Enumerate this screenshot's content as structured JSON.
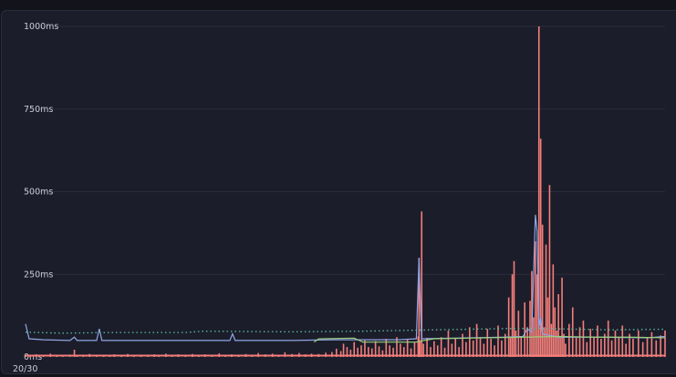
{
  "chart_data": {
    "type": "line",
    "ylim": [
      0,
      1000
    ],
    "yticks": [
      {
        "value": 0,
        "label": "0ms"
      },
      {
        "value": 250,
        "label": "250ms"
      },
      {
        "value": 500,
        "label": "500ms"
      },
      {
        "value": 750,
        "label": "750ms"
      },
      {
        "value": 1000,
        "label": "1000ms"
      }
    ],
    "xtick_label": "20/30",
    "grid": true,
    "legend": "none",
    "series": [
      {
        "color": "#f47e7a",
        "style": "spikes",
        "points": [
          [
            0,
            4
          ],
          [
            5,
            6
          ],
          [
            12,
            8
          ],
          [
            20,
            5
          ],
          [
            28,
            10
          ],
          [
            35,
            4
          ],
          [
            42,
            6
          ],
          [
            50,
            7
          ],
          [
            55,
            22
          ],
          [
            58,
            6
          ],
          [
            65,
            5
          ],
          [
            72,
            9
          ],
          [
            80,
            6
          ],
          [
            88,
            7
          ],
          [
            95,
            5
          ],
          [
            100,
            8
          ],
          [
            108,
            6
          ],
          [
            115,
            9
          ],
          [
            122,
            5
          ],
          [
            130,
            7
          ],
          [
            138,
            6
          ],
          [
            145,
            8
          ],
          [
            150,
            5
          ],
          [
            158,
            10
          ],
          [
            165,
            6
          ],
          [
            172,
            8
          ],
          [
            180,
            5
          ],
          [
            188,
            9
          ],
          [
            195,
            6
          ],
          [
            202,
            8
          ],
          [
            210,
            5
          ],
          [
            218,
            11
          ],
          [
            225,
            6
          ],
          [
            232,
            8
          ],
          [
            240,
            7
          ],
          [
            248,
            9
          ],
          [
            255,
            6
          ],
          [
            262,
            12
          ],
          [
            270,
            8
          ],
          [
            278,
            10
          ],
          [
            285,
            7
          ],
          [
            292,
            14
          ],
          [
            300,
            9
          ],
          [
            308,
            12
          ],
          [
            315,
            8
          ],
          [
            322,
            10
          ],
          [
            330,
            9
          ],
          [
            338,
            13
          ],
          [
            345,
            15
          ],
          [
            350,
            25
          ],
          [
            355,
            18
          ],
          [
            358,
            40
          ],
          [
            362,
            30
          ],
          [
            366,
            22
          ],
          [
            370,
            45
          ],
          [
            374,
            28
          ],
          [
            378,
            35
          ],
          [
            382,
            50
          ],
          [
            386,
            30
          ],
          [
            390,
            26
          ],
          [
            394,
            48
          ],
          [
            398,
            32
          ],
          [
            402,
            20
          ],
          [
            406,
            55
          ],
          [
            410,
            35
          ],
          [
            414,
            28
          ],
          [
            418,
            60
          ],
          [
            422,
            40
          ],
          [
            426,
            30
          ],
          [
            430,
            52
          ],
          [
            434,
            26
          ],
          [
            438,
            45
          ],
          [
            442,
            62
          ],
          [
            443,
            300
          ],
          [
            444,
            50
          ],
          [
            446,
            440
          ],
          [
            448,
            40
          ],
          [
            452,
            58
          ],
          [
            456,
            30
          ],
          [
            460,
            48
          ],
          [
            464,
            35
          ],
          [
            468,
            60
          ],
          [
            472,
            28
          ],
          [
            476,
            80
          ],
          [
            480,
            40
          ],
          [
            484,
            55
          ],
          [
            488,
            30
          ],
          [
            492,
            70
          ],
          [
            496,
            45
          ],
          [
            500,
            90
          ],
          [
            504,
            50
          ],
          [
            508,
            100
          ],
          [
            512,
            60
          ],
          [
            516,
            40
          ],
          [
            520,
            85
          ],
          [
            524,
            55
          ],
          [
            528,
            35
          ],
          [
            532,
            95
          ],
          [
            536,
            50
          ],
          [
            540,
            70
          ],
          [
            544,
            180
          ],
          [
            546,
            60
          ],
          [
            548,
            250
          ],
          [
            550,
            290
          ],
          [
            552,
            80
          ],
          [
            555,
            140
          ],
          [
            558,
            60
          ],
          [
            562,
            165
          ],
          [
            565,
            90
          ],
          [
            568,
            170
          ],
          [
            570,
            260
          ],
          [
            572,
            120
          ],
          [
            574,
            350
          ],
          [
            576,
            250
          ],
          [
            578,
            1000
          ],
          [
            580,
            660
          ],
          [
            582,
            400
          ],
          [
            584,
            90
          ],
          [
            586,
            340
          ],
          [
            588,
            180
          ],
          [
            590,
            520
          ],
          [
            592,
            100
          ],
          [
            594,
            280
          ],
          [
            596,
            150
          ],
          [
            598,
            80
          ],
          [
            600,
            190
          ],
          [
            602,
            60
          ],
          [
            604,
            240
          ],
          [
            606,
            70
          ],
          [
            608,
            40
          ],
          [
            612,
            100
          ],
          [
            616,
            150
          ],
          [
            620,
            60
          ],
          [
            624,
            90
          ],
          [
            628,
            110
          ],
          [
            632,
            45
          ],
          [
            636,
            85
          ],
          [
            640,
            60
          ],
          [
            644,
            95
          ],
          [
            648,
            55
          ],
          [
            652,
            70
          ],
          [
            656,
            110
          ],
          [
            660,
            50
          ],
          [
            664,
            80
          ],
          [
            668,
            60
          ],
          [
            672,
            95
          ],
          [
            676,
            40
          ],
          [
            680,
            70
          ],
          [
            684,
            55
          ],
          [
            690,
            80
          ],
          [
            695,
            45
          ],
          [
            700,
            60
          ],
          [
            705,
            75
          ],
          [
            710,
            50
          ],
          [
            715,
            65
          ],
          [
            720,
            80
          ]
        ]
      },
      {
        "color": "#8fa6e6",
        "style": "line",
        "points": [
          [
            0,
            100
          ],
          [
            4,
            55
          ],
          [
            20,
            52
          ],
          [
            50,
            50
          ],
          [
            55,
            60
          ],
          [
            58,
            50
          ],
          [
            80,
            50
          ],
          [
            83,
            85
          ],
          [
            86,
            50
          ],
          [
            150,
            50
          ],
          [
            230,
            50
          ],
          [
            233,
            70
          ],
          [
            236,
            50
          ],
          [
            300,
            50
          ],
          [
            345,
            52
          ],
          [
            420,
            52
          ],
          [
            440,
            55
          ],
          [
            443,
            300
          ],
          [
            444,
            200
          ],
          [
            446,
            55
          ],
          [
            500,
            58
          ],
          [
            540,
            60
          ],
          [
            560,
            62
          ],
          [
            565,
            85
          ],
          [
            570,
            75
          ],
          [
            574,
            430
          ],
          [
            576,
            380
          ],
          [
            578,
            90
          ],
          [
            580,
            120
          ],
          [
            582,
            70
          ],
          [
            590,
            65
          ],
          [
            600,
            60
          ],
          [
            640,
            60
          ],
          [
            700,
            58
          ],
          [
            720,
            62
          ]
        ]
      },
      {
        "color": "#5bc0a0",
        "style": "dotted",
        "points": [
          [
            0,
            75
          ],
          [
            40,
            72
          ],
          [
            100,
            74
          ],
          [
            180,
            74
          ],
          [
            200,
            78
          ],
          [
            300,
            76
          ],
          [
            380,
            78
          ],
          [
            420,
            80
          ],
          [
            460,
            82
          ],
          [
            500,
            84
          ],
          [
            540,
            86
          ],
          [
            580,
            86
          ],
          [
            620,
            84
          ],
          [
            660,
            82
          ],
          [
            720,
            84
          ]
        ]
      },
      {
        "color": "#9bd07a",
        "style": "line",
        "points": [
          [
            325,
            45
          ],
          [
            330,
            55
          ],
          [
            370,
            57
          ],
          [
            380,
            45
          ],
          [
            440,
            45
          ],
          [
            445,
            48
          ],
          [
            460,
            55
          ],
          [
            520,
            58
          ],
          [
            560,
            60
          ],
          [
            600,
            62
          ],
          [
            640,
            60
          ],
          [
            680,
            60
          ],
          [
            720,
            58
          ]
        ]
      }
    ]
  }
}
